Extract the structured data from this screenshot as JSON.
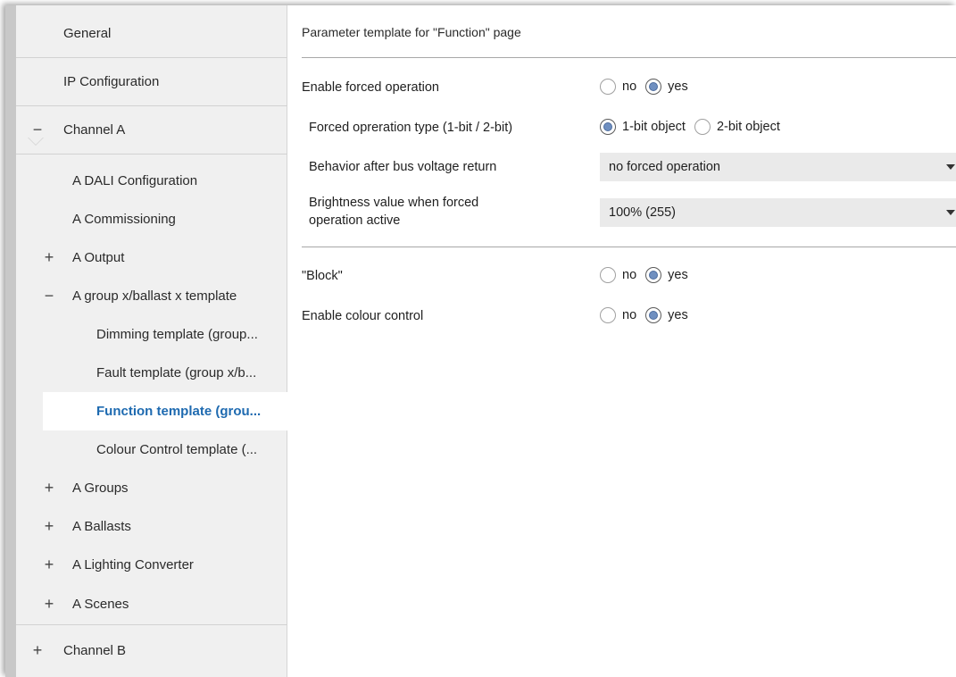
{
  "sidebar": {
    "items": [
      {
        "label": "General",
        "sign": ""
      },
      {
        "label": "IP Configuration",
        "sign": ""
      },
      {
        "label": "Channel A",
        "sign": "−"
      },
      {
        "label": "A DALI Configuration",
        "sign": ""
      },
      {
        "label": "A Commissioning",
        "sign": ""
      },
      {
        "label": "A Output",
        "sign": "+"
      },
      {
        "label": "A group x/ballast x template",
        "sign": "−"
      },
      {
        "label": "Dimming template (group...",
        "sign": ""
      },
      {
        "label": "Fault template  (group x/b...",
        "sign": ""
      },
      {
        "label": "Function template (grou...",
        "sign": ""
      },
      {
        "label": "Colour Control template (...",
        "sign": ""
      },
      {
        "label": "A Groups",
        "sign": "+"
      },
      {
        "label": "A Ballasts",
        "sign": "+"
      },
      {
        "label": "A Lighting Converter",
        "sign": "+"
      },
      {
        "label": "A Scenes",
        "sign": "+"
      },
      {
        "label": "Channel B",
        "sign": "+"
      }
    ]
  },
  "main": {
    "header": "Parameter template for \"Function\" page",
    "params": {
      "forced": {
        "label": "Enable forced operation",
        "opt1": "no",
        "opt2": "yes",
        "selected": "yes"
      },
      "forced_type": {
        "label": "Forced opreration type (1-bit / 2-bit)",
        "opt1": "1-bit object",
        "opt2": "2-bit object",
        "selected": "1-bit object"
      },
      "behavior": {
        "label": "Behavior after bus voltage return",
        "value": "no forced operation"
      },
      "brightness": {
        "label_line1": "Brightness value when forced",
        "label_line2": "operation active",
        "value": "100% (255)"
      },
      "block": {
        "label": "\"Block\"",
        "opt1": "no",
        "opt2": "yes",
        "selected": "yes"
      },
      "colour": {
        "label": "Enable colour control",
        "opt1": "no",
        "opt2": "yes",
        "selected": "yes"
      }
    }
  },
  "colors": {
    "active_text": "#1e6ab0",
    "sidebar_bg": "#f0f0f0",
    "radio_fill": "#6f8fc0",
    "dropdown_bg": "#eaeaea"
  }
}
